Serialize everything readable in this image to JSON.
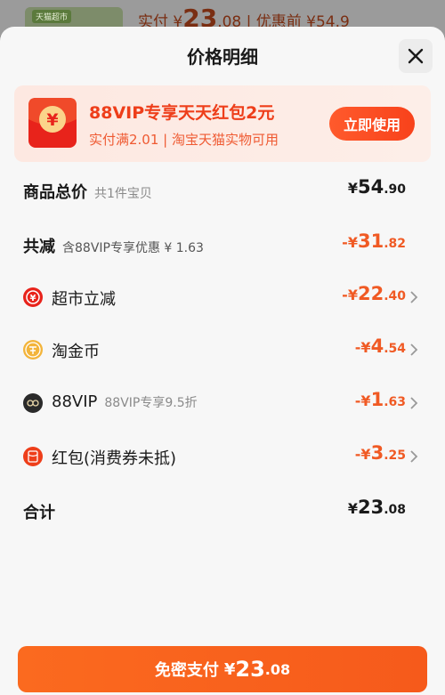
{
  "background": {
    "thumb_badge": "天猫超市",
    "text_prefix": "实付 ¥",
    "text_big": "23",
    "text_suffix": ".08 | 优惠前 ¥54.9"
  },
  "header": {
    "title": "价格明细"
  },
  "promo": {
    "title": "88VIP专享天天红包2元",
    "subtitle": "实付满2.01 | 淘宝天猫实物可用",
    "button_label": "立即使用"
  },
  "rows": {
    "total": {
      "label": "商品总价",
      "hint": "共1件宝贝",
      "currency": "¥",
      "int": "54",
      "dec": ".90"
    },
    "discount": {
      "label": "共减",
      "hint": "含88VIP专享优惠 ¥ 1.63",
      "currency": "-¥",
      "int": "31",
      "dec": ".82"
    },
    "supermarket": {
      "label": "超市立减",
      "currency": "-¥",
      "int": "22",
      "dec": ".40"
    },
    "coins": {
      "label": "淘金币",
      "currency": "-¥",
      "int": "4",
      "dec": ".54"
    },
    "vip": {
      "label": "88VIP",
      "hint": "88VIP专享9.5折",
      "currency": "-¥",
      "int": "1",
      "dec": ".63"
    },
    "redpacket": {
      "label": "红包(消费券未抵)",
      "currency": "-¥",
      "int": "3",
      "dec": ".25"
    },
    "sum": {
      "label": "合计",
      "currency": "¥",
      "int": "23",
      "dec": ".08"
    }
  },
  "pay_button": {
    "label": "免密支付",
    "currency": "¥",
    "int": "23",
    "dec": ".08"
  },
  "colors": {
    "accent": "#f05a24",
    "promo_red": "#ee3e1a",
    "button_orange": "#fb6a1f"
  }
}
